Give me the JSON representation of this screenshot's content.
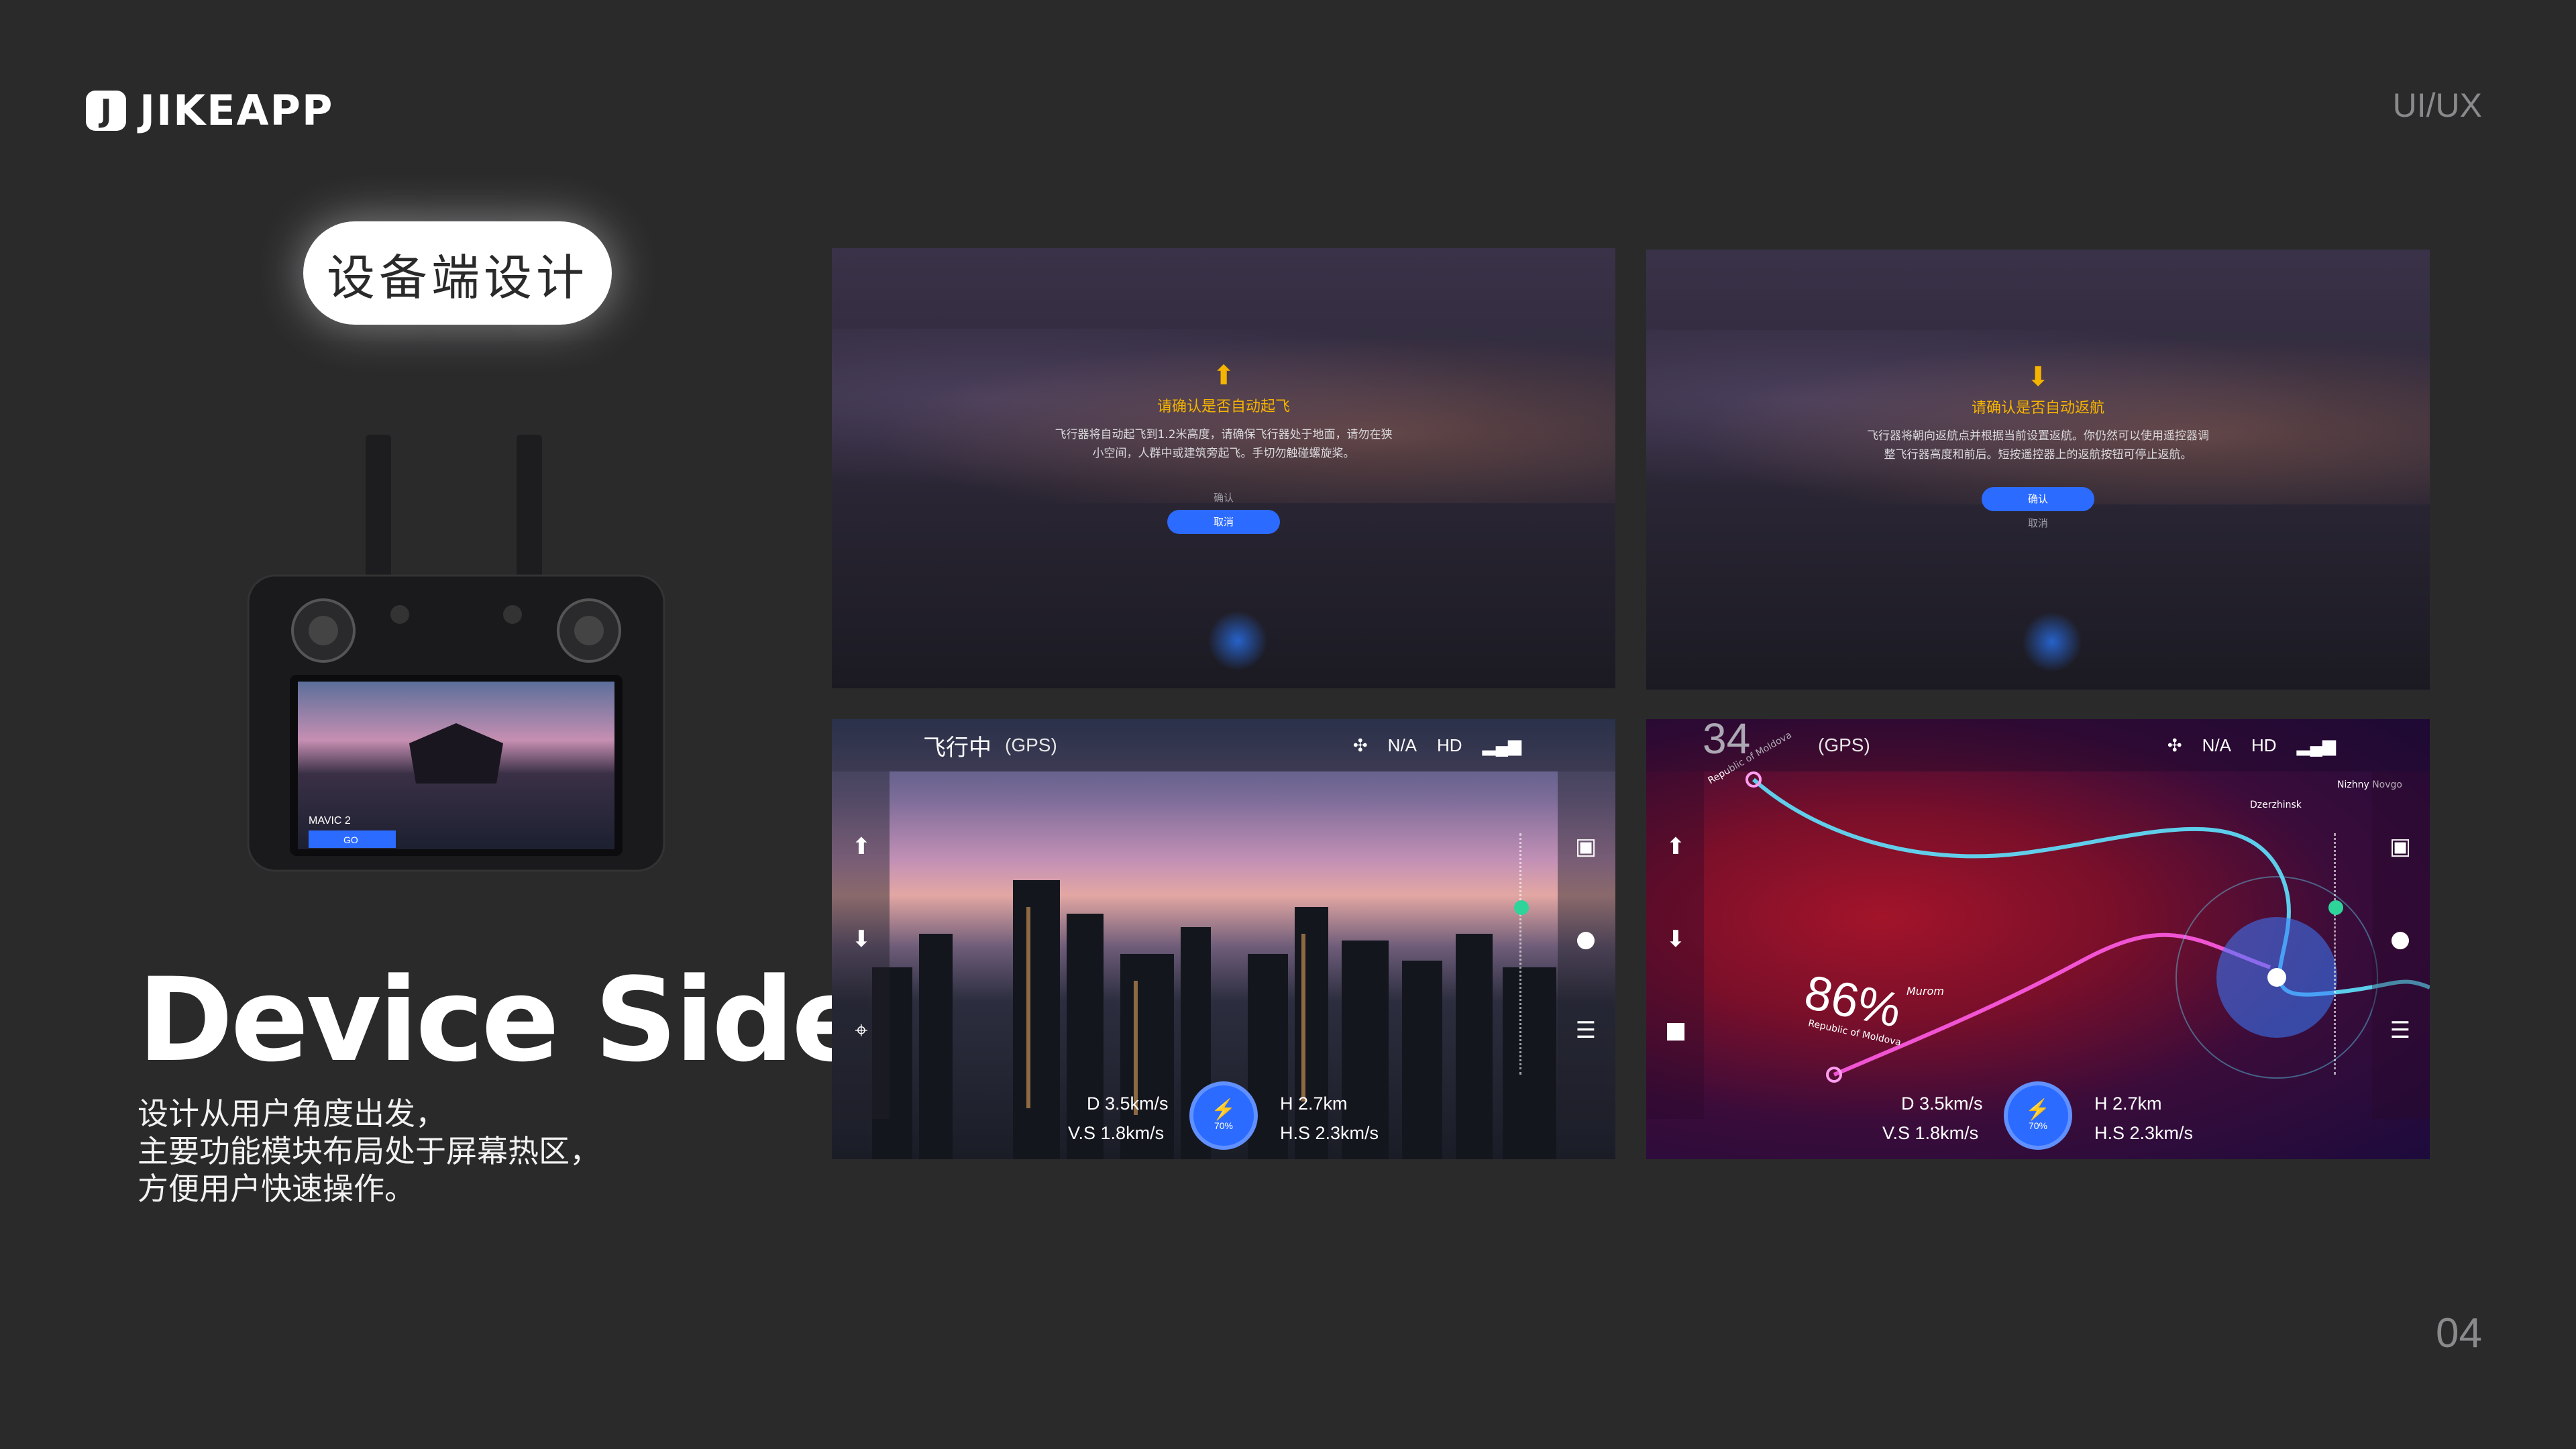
{
  "header": {
    "logo_letter": "J",
    "logo_text": "JIKEAPP",
    "section_tag": "UI/UX"
  },
  "page_number": "04",
  "left": {
    "pill_label": "设备端设计",
    "device": {
      "screen_model": "MAVIC 2",
      "screen_button": "GO"
    },
    "heading": "Device Side",
    "description_lines": [
      "设计从用户角度出发，",
      "主要功能模块布局处于屏幕热区，",
      "方便用户快速操作。"
    ]
  },
  "panels": {
    "takeoff": {
      "title": "请确认是否自动起飞",
      "body": "飞行器将自动起飞到1.2米高度，请确保飞行器处于地面，请勿在狭小空间，人群中或建筑旁起飞。手切勿触碰螺旋桨。",
      "confirm": "确认",
      "cancel": "取消"
    },
    "return": {
      "title": "请确认是否自动返航",
      "body": "飞行器将朝向返航点并根据当前设置返航。你仍然可以使用遥控器调整飞行器高度和前后。短按遥控器上的返航按钮可停止返航。",
      "confirm": "确认",
      "cancel": "取消"
    },
    "flight": {
      "status": "飞行中",
      "gps": "(GPS)",
      "signal_na": "N/A",
      "hd": "HD",
      "d": "D  3.5km/s",
      "vs": "V.S 1.8km/s",
      "h": "H  2.7km",
      "hs": "H.S 2.3km/s",
      "battery": "70%"
    },
    "map": {
      "gps": "(GPS)",
      "signal_na": "N/A",
      "hd": "HD",
      "corner_value": "34",
      "percent": "86%",
      "region1": "Republic of Moldova",
      "region2": "Republic of Moldova",
      "place1": "Murom",
      "place2": "Dzerzhinsk",
      "place3": "Nizhny Novgo",
      "d": "D  3.5km/s",
      "vs": "V.S 1.8km/s",
      "h": "H  2.7km",
      "hs": "H.S 2.3km/s",
      "battery": "70%"
    }
  },
  "colors": {
    "background": "#2a2a2b",
    "accent_blue": "#2c6bff",
    "warning": "#f5b400",
    "route_cyan": "#5ee3ff",
    "route_pink": "#ff5ce6"
  },
  "icons": [
    "drone-icon",
    "signal-icon",
    "camera-icon",
    "record-icon",
    "settings-icon",
    "takeoff-icon",
    "landing-icon",
    "location-icon",
    "video-icon",
    "battery-icon"
  ]
}
